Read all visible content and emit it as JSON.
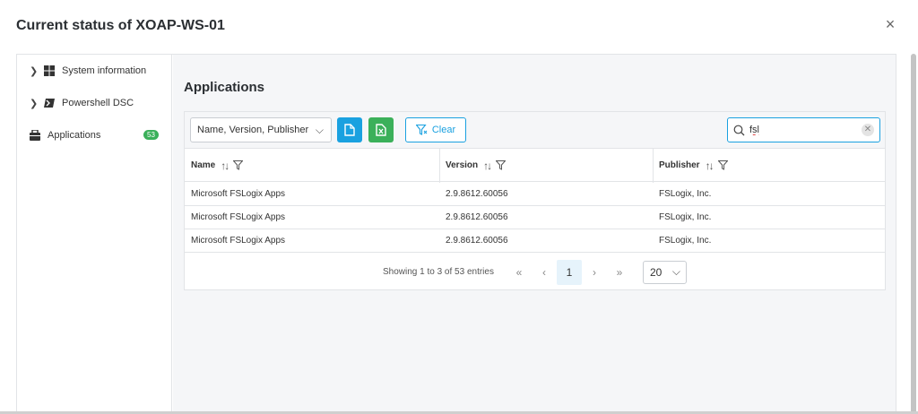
{
  "dialog": {
    "title": "Current status of XOAP-WS-01",
    "close_icon": "×"
  },
  "sidebar": {
    "items": [
      {
        "label": "System information",
        "icon": "windows-icon",
        "expandable": true
      },
      {
        "label": "Powershell DSC",
        "icon": "powershell-icon",
        "expandable": true
      },
      {
        "label": "Applications",
        "icon": "applications-icon",
        "expandable": false,
        "badge": "53"
      }
    ]
  },
  "main": {
    "title": "Applications",
    "toolbar": {
      "column_select_value": "Name, Version, Publisher",
      "clear_label": "Clear",
      "search_value": "fsl"
    },
    "table": {
      "headers": [
        "Name",
        "Version",
        "Publisher"
      ],
      "rows": [
        [
          "Microsoft FSLogix Apps",
          "2.9.8612.60056",
          "FSLogix, Inc."
        ],
        [
          "Microsoft FSLogix Apps",
          "2.9.8612.60056",
          "FSLogix, Inc."
        ],
        [
          "Microsoft FSLogix Apps",
          "2.9.8612.60056",
          "FSLogix, Inc."
        ]
      ]
    },
    "pager": {
      "info": "Showing 1 to 3 of 53 entries",
      "current_page": "1",
      "page_size": "20"
    }
  },
  "colors": {
    "accent": "#1aa1e0",
    "success": "#3bb05a"
  }
}
